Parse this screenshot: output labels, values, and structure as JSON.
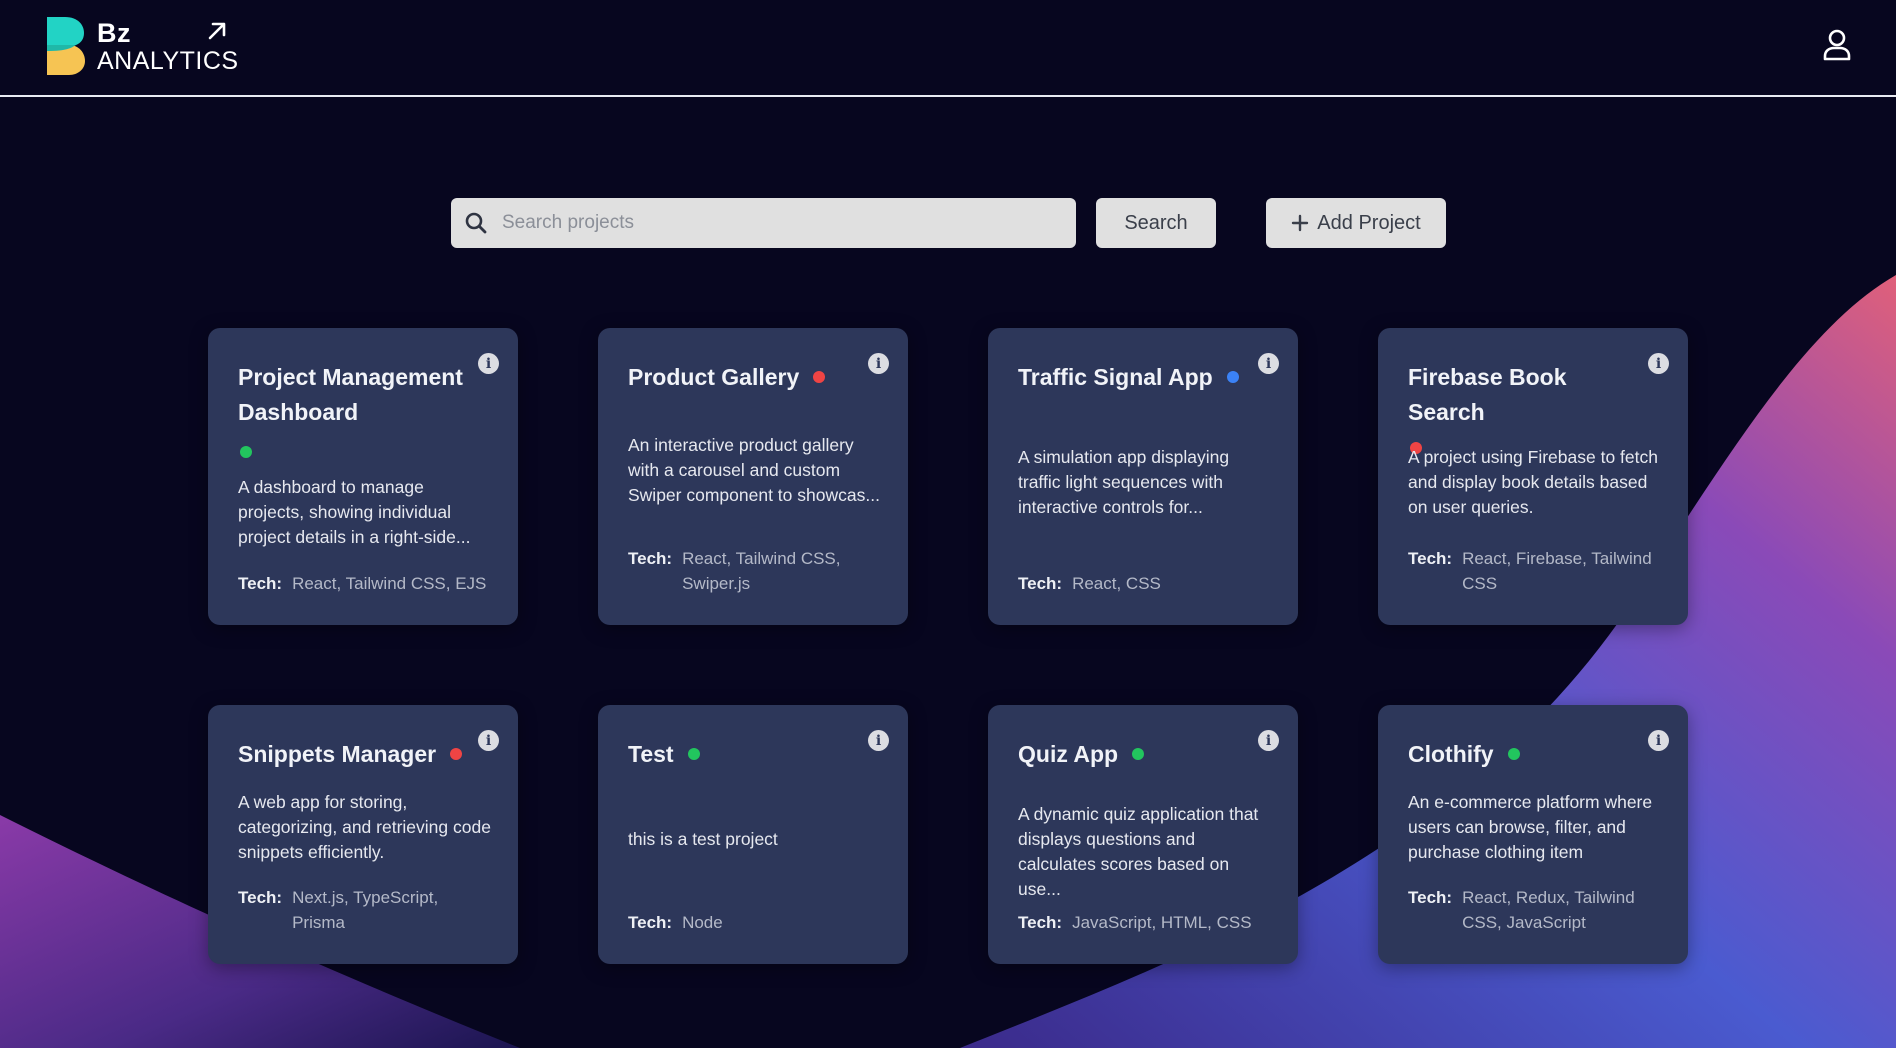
{
  "brand": {
    "line1": "Bz",
    "line2": "ANALYTICS"
  },
  "search": {
    "placeholder": "Search projects",
    "value": "",
    "button_label": "Search"
  },
  "add_project": {
    "label": "Add Project"
  },
  "tech_label": "Tech:",
  "projects": [
    {
      "title": "Project Management Dashboard",
      "status": "green",
      "description": "A dashboard to manage projects, showing individual project details in a right-side...",
      "tech": "React, Tailwind CSS, EJS"
    },
    {
      "title": "Product Gallery",
      "status": "red",
      "description": "An interactive product gallery with a carousel and custom Swiper component to showcas...",
      "tech": "React, Tailwind CSS, Swiper.js"
    },
    {
      "title": "Traffic Signal App",
      "status": "blue",
      "description": "A simulation app displaying traffic light sequences with interactive controls for...",
      "tech": "React, CSS"
    },
    {
      "title": "Firebase Book Search",
      "status": "red",
      "description": "A project using Firebase to fetch and display book details based on user queries.",
      "tech": "React, Firebase, Tailwind CSS"
    },
    {
      "title": "Snippets Manager",
      "status": "red",
      "description": "A web app for storing, categorizing, and retrieving code snippets efficiently.",
      "tech": "Next.js, TypeScript, Prisma"
    },
    {
      "title": "Test",
      "status": "green",
      "description": "this is a test project",
      "tech": "Node"
    },
    {
      "title": "Quiz App",
      "status": "green",
      "description": "A dynamic quiz application that displays questions and calculates scores based on use...",
      "tech": "JavaScript, HTML, CSS"
    },
    {
      "title": "Clothify",
      "status": "green",
      "description": "An e-commerce platform where users can browse, filter, and purchase clothing item",
      "tech": "React, Redux, Tailwind CSS, JavaScript"
    }
  ],
  "status_colors": {
    "green": "#22c55e",
    "red": "#ef4444",
    "blue": "#3b82f6"
  },
  "icons": {
    "search": "search-icon",
    "user": "user-icon",
    "info": "info-icon",
    "add": "plus-icon",
    "logo_arrow": "arrow-up-right-icon"
  }
}
